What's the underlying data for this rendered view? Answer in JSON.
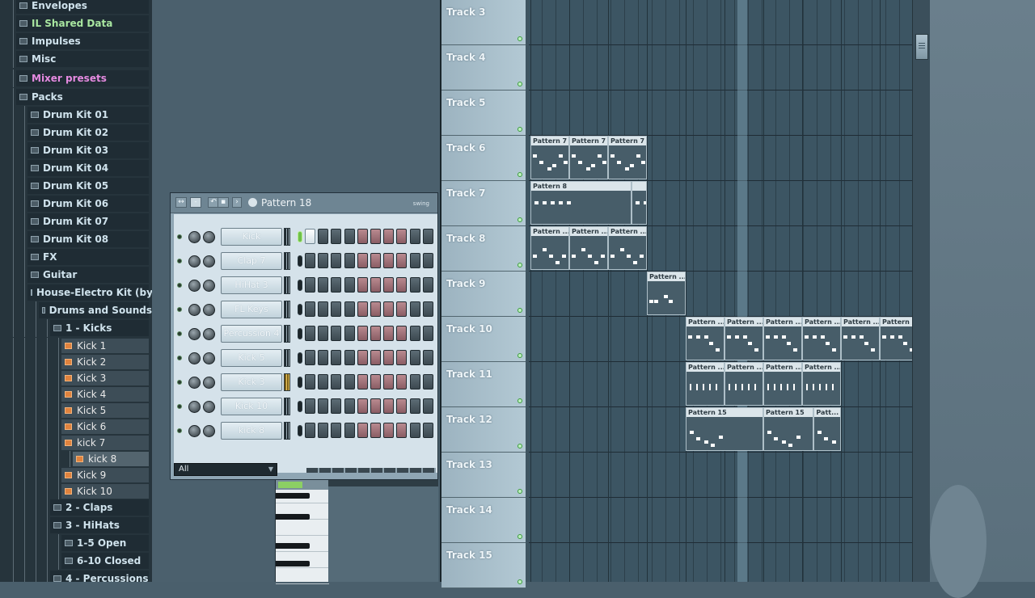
{
  "browser": {
    "items": [
      {
        "label": "Envelopes",
        "kind": "folder",
        "indent": 1
      },
      {
        "label": "IL Shared Data",
        "kind": "folder",
        "indent": 1,
        "color": "green"
      },
      {
        "label": "Impulses",
        "kind": "folder",
        "indent": 1
      },
      {
        "label": "Misc",
        "kind": "folder",
        "indent": 1
      },
      {
        "label": "Mixer presets",
        "kind": "folder",
        "indent": 1,
        "color": "pink"
      },
      {
        "label": "Packs",
        "kind": "folder",
        "indent": 1
      },
      {
        "label": "Drum Kit 01",
        "kind": "folder",
        "indent": 2
      },
      {
        "label": "Drum Kit 02",
        "kind": "folder",
        "indent": 2
      },
      {
        "label": "Drum Kit 03",
        "kind": "folder",
        "indent": 2
      },
      {
        "label": "Drum Kit 04",
        "kind": "folder",
        "indent": 2
      },
      {
        "label": "Drum Kit 05",
        "kind": "folder",
        "indent": 2
      },
      {
        "label": "Drum Kit 06",
        "kind": "folder",
        "indent": 2
      },
      {
        "label": "Drum Kit 07",
        "kind": "folder",
        "indent": 2
      },
      {
        "label": "Drum Kit 08",
        "kind": "folder",
        "indent": 2
      },
      {
        "label": "FX",
        "kind": "folder",
        "indent": 2
      },
      {
        "label": "Guitar",
        "kind": "folder",
        "indent": 2
      },
      {
        "label": "House-Electro Kit (by...",
        "kind": "folder",
        "indent": 2
      },
      {
        "label": "Drums and Sounds",
        "kind": "folder",
        "indent": 3
      },
      {
        "label": "1 - Kicks",
        "kind": "folder",
        "indent": 4
      },
      {
        "label": "Kick 1",
        "kind": "sample",
        "indent": 5
      },
      {
        "label": "Kick 2",
        "kind": "sample",
        "indent": 5
      },
      {
        "label": "Kick 3",
        "kind": "sample",
        "indent": 5
      },
      {
        "label": "Kick 4",
        "kind": "sample",
        "indent": 5
      },
      {
        "label": "Kick 5",
        "kind": "sample",
        "indent": 5
      },
      {
        "label": "Kick 6",
        "kind": "sample",
        "indent": 5
      },
      {
        "label": "kick 7",
        "kind": "sample",
        "indent": 5
      },
      {
        "label": "kick 8",
        "kind": "sample",
        "indent": 6,
        "selected": true
      },
      {
        "label": "Kick 9",
        "kind": "sample",
        "indent": 5
      },
      {
        "label": "Kick 10",
        "kind": "sample",
        "indent": 5
      },
      {
        "label": "2 - Claps",
        "kind": "folder",
        "indent": 4
      },
      {
        "label": "3 - HiHats",
        "kind": "folder",
        "indent": 4
      },
      {
        "label": "1-5 Open",
        "kind": "folder",
        "indent": 5
      },
      {
        "label": "6-10 Closed",
        "kind": "folder",
        "indent": 5
      },
      {
        "label": "4 - Percussions",
        "kind": "folder",
        "indent": 4
      }
    ]
  },
  "channel_rack": {
    "pattern_label": "Pattern 18",
    "swing_label": "swing",
    "filter_value": "All",
    "channels": [
      {
        "name": "Kick",
        "selected": true,
        "steps": [
          1,
          0,
          0,
          0,
          0,
          0,
          0,
          0,
          0,
          0
        ]
      },
      {
        "name": "Clap 7",
        "selected": false,
        "steps": [
          0,
          0,
          0,
          0,
          0,
          0,
          0,
          0,
          0,
          0
        ]
      },
      {
        "name": "HiHat 3",
        "selected": false,
        "steps": [
          0,
          0,
          0,
          0,
          0,
          0,
          0,
          0,
          0,
          0
        ]
      },
      {
        "name": "FL Keys",
        "selected": false,
        "steps": [
          0,
          0,
          0,
          0,
          0,
          0,
          0,
          0,
          0,
          0
        ]
      },
      {
        "name": "Percussion 4",
        "selected": false,
        "steps": [
          0,
          0,
          0,
          0,
          0,
          0,
          0,
          0,
          0,
          0
        ]
      },
      {
        "name": "Kick 5",
        "selected": false,
        "steps": [
          0,
          0,
          0,
          0,
          0,
          0,
          0,
          0,
          0,
          0
        ]
      },
      {
        "name": "Kick 3",
        "selected": false,
        "lit": true,
        "steps": [
          0,
          0,
          0,
          0,
          0,
          0,
          0,
          0,
          0,
          0
        ]
      },
      {
        "name": "Kick 10",
        "selected": false,
        "steps": [
          0,
          0,
          0,
          0,
          0,
          0,
          0,
          0,
          0,
          0
        ]
      },
      {
        "name": "kick 8",
        "selected": false,
        "steps": [
          0,
          0,
          0,
          0,
          0,
          0,
          0,
          0,
          0,
          0
        ]
      }
    ]
  },
  "playlist": {
    "tracks": [
      "Track 3",
      "Track 4",
      "Track 5",
      "Track 6",
      "Track 7",
      "Track 8",
      "Track 9",
      "Track 10",
      "Track 11",
      "Track 12",
      "Track 13",
      "Track 14",
      "Track 15"
    ],
    "clips": [
      {
        "track": "Track 6",
        "label": "Pattern 7",
        "bar": 0
      },
      {
        "track": "Track 6",
        "label": "Pattern 7",
        "bar": 1
      },
      {
        "track": "Track 6",
        "label": "Pattern 7",
        "bar": 2
      },
      {
        "track": "Track 7",
        "label": "Pattern 8",
        "bar": 0,
        "length": 2.6
      },
      {
        "track": "Track 7",
        "label": "",
        "bar": 2.6,
        "length": 0.4
      },
      {
        "track": "Track 8",
        "label": "Pattern ...",
        "bar": 0
      },
      {
        "track": "Track 8",
        "label": "Pattern ...",
        "bar": 1
      },
      {
        "track": "Track 8",
        "label": "Pattern ...",
        "bar": 2
      },
      {
        "track": "Track 9",
        "label": "Pattern ...",
        "bar": 3
      },
      {
        "track": "Track 10",
        "label": "Pattern ...",
        "bar": 4
      },
      {
        "track": "Track 10",
        "label": "Pattern ...",
        "bar": 5
      },
      {
        "track": "Track 10",
        "label": "Pattern ...",
        "bar": 6
      },
      {
        "track": "Track 10",
        "label": "Pattern ...",
        "bar": 7
      },
      {
        "track": "Track 10",
        "label": "Pattern ...",
        "bar": 8
      },
      {
        "track": "Track 10",
        "label": "Pattern ...",
        "bar": 9
      },
      {
        "track": "Track 11",
        "label": "Pattern ...",
        "bar": 4
      },
      {
        "track": "Track 11",
        "label": "Pattern ...",
        "bar": 5
      },
      {
        "track": "Track 11",
        "label": "Pattern ...",
        "bar": 6
      },
      {
        "track": "Track 11",
        "label": "Pattern ...",
        "bar": 7
      },
      {
        "track": "Track 12",
        "label": "Pattern 15",
        "bar": 4,
        "length": 2
      },
      {
        "track": "Track 12",
        "label": "Pattern 15",
        "bar": 6,
        "length": 1.3
      },
      {
        "track": "Track 12",
        "label": "Patt...",
        "bar": 7.3,
        "length": 0.7
      }
    ]
  },
  "colors": {
    "accent": "#8ccf64",
    "pink": "#e58ae0",
    "sample_icon": "#e0833e"
  }
}
